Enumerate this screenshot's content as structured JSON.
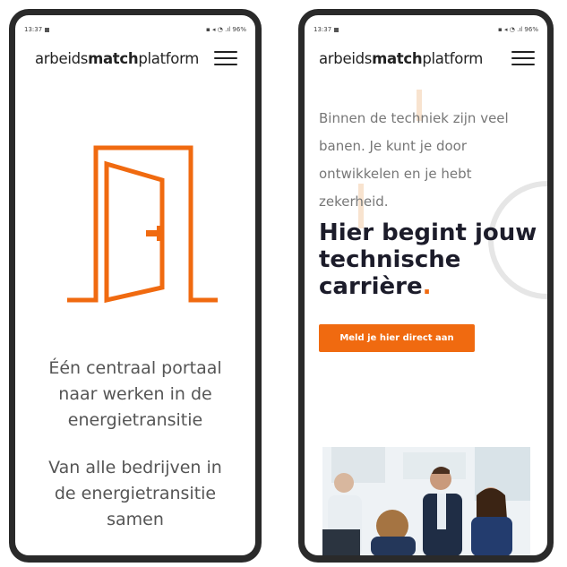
{
  "left_phone": {
    "status": {
      "time": "13:37",
      "indicators": "▪ ◂ ◔ .ıl 96%"
    },
    "logo": {
      "part1": "arbeids",
      "part2": "match",
      "part3": "platform"
    },
    "line1": "Één centraal portaal",
    "line2": "naar werken in de",
    "line3": "energietransitie",
    "line4": "Van alle bedrijven in",
    "line5": "de energietransitie",
    "line6": "samen",
    "accent": "#f06a10"
  },
  "right_phone": {
    "status": {
      "time": "13:37",
      "indicators": "▪ ◂ ◔ .ıl 96%"
    },
    "logo": {
      "part1": "arbeids",
      "part2": "match",
      "part3": "platform"
    },
    "intro": {
      "l1": "Binnen de techniek zijn veel",
      "l2": "banen. Je kunt je door",
      "l3": "ontwikkelen en je hebt",
      "l4": "zekerheid."
    },
    "headline": {
      "l1": "Hier begint jouw",
      "l2": "technische",
      "l3": "carrière",
      "dot": "."
    },
    "cta_label": "Meld je hier direct aan",
    "accent": "#f06a10"
  }
}
